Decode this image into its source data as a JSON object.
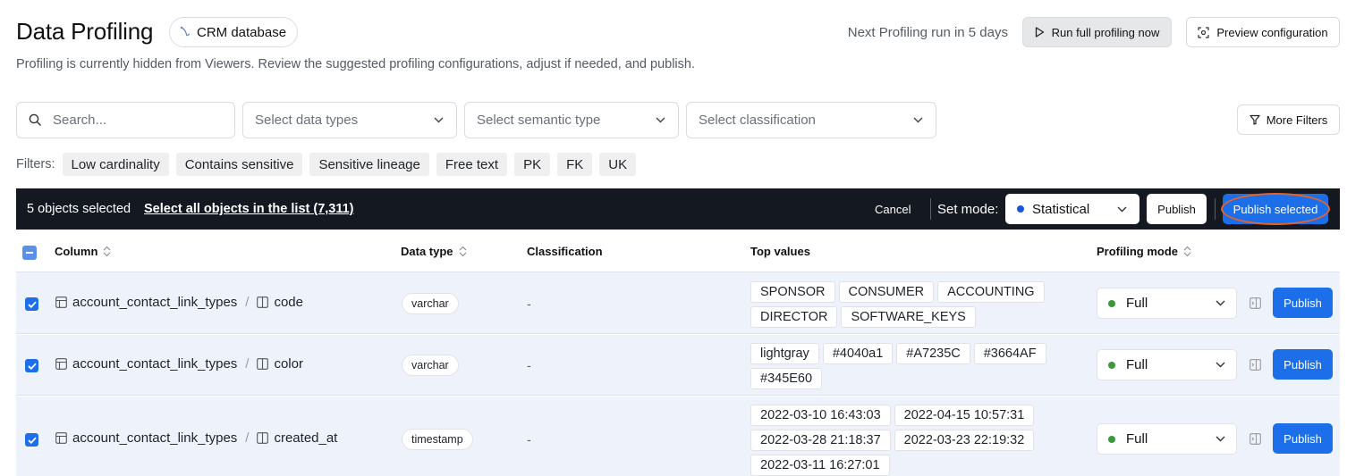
{
  "header": {
    "title": "Data Profiling",
    "database_label": "CRM database",
    "next_run": "Next Profiling run in 5 days",
    "run_button": "Run full profiling now",
    "preview_button": "Preview configuration",
    "subtitle": "Profiling is currently hidden from Viewers. Review the suggested profiling configurations, adjust if needed, and publish."
  },
  "filters": {
    "search_placeholder": "Search...",
    "data_types_placeholder": "Select data types",
    "semantic_placeholder": "Select semantic type",
    "classification_placeholder": "Select classification",
    "more_filters": "More Filters",
    "chips_label": "Filters:",
    "chips": [
      "Low cardinality",
      "Contains sensitive",
      "Sensitive lineage",
      "Free text",
      "PK",
      "FK",
      "UK"
    ]
  },
  "selection_bar": {
    "count_text": "5 objects selected",
    "select_all": "Select all objects in the list (7,311)",
    "cancel": "Cancel",
    "set_mode_label": "Set mode:",
    "mode_value": "Statistical",
    "publish": "Publish",
    "publish_selected": "Publish selected"
  },
  "table": {
    "headers": {
      "column": "Column",
      "data_type": "Data type",
      "classification": "Classification",
      "top_values": "Top values",
      "profiling_mode": "Profiling mode"
    },
    "rows": [
      {
        "table_name": "account_contact_link_types",
        "separator": "/",
        "column_name": "code",
        "data_type": "varchar",
        "classification": "-",
        "top_values": [
          "SPONSOR",
          "CONSUMER",
          "ACCOUNTING",
          "DIRECTOR",
          "SOFTWARE_KEYS"
        ],
        "mode": "Full",
        "publish": "Publish"
      },
      {
        "table_name": "account_contact_link_types",
        "separator": "/",
        "column_name": "color",
        "data_type": "varchar",
        "classification": "-",
        "top_values": [
          "lightgray",
          "#4040a1",
          "#A7235C",
          "#3664AF",
          "#345E60"
        ],
        "mode": "Full",
        "publish": "Publish"
      },
      {
        "table_name": "account_contact_link_types",
        "separator": "/",
        "column_name": "created_at",
        "data_type": "timestamp",
        "classification": "-",
        "top_values": [
          "2022-03-10 16:43:03",
          "2022-04-15 10:57:31",
          "2022-03-28 21:18:37",
          "2022-03-23 22:19:32",
          "2022-03-11 16:27:01"
        ],
        "mode": "Full",
        "publish": "Publish"
      }
    ]
  },
  "colors": {
    "accent": "#1c6fe8",
    "selection_bar_bg": "#141820",
    "row_selected_bg": "#eef3fb",
    "mode_full_dot": "#3a9a3a",
    "mode_statistical_dot": "#1a56db",
    "highlight_ring": "#e5622a"
  }
}
